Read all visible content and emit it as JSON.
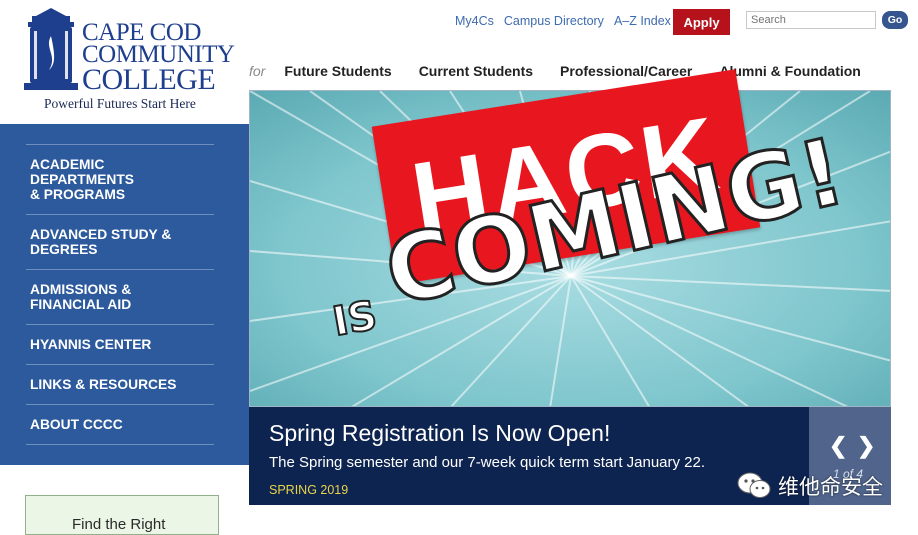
{
  "logo": {
    "line1": "CAPE COD",
    "line2": "COMMUNITY",
    "line3": "COLLEGE",
    "tagline": "Powerful Futures Start Here",
    "icon": "lighthouse-icon"
  },
  "utility_nav": {
    "links": [
      "My4Cs",
      "Campus Directory",
      "A–Z Index"
    ],
    "apply_label": "Apply",
    "search_placeholder": "Search",
    "go_label": "Go"
  },
  "main_nav": {
    "prefix": "for",
    "items": [
      "Future Students",
      "Current Students",
      "Professional/Career",
      "Alumni & Foundation"
    ]
  },
  "sidebar": {
    "items": [
      {
        "label": "ACADEMIC\nDEPARTMENTS\n& PROGRAMS"
      },
      {
        "label": "ADVANCED STUDY &\nDEGREES"
      },
      {
        "label": "ADMISSIONS &\nFINANCIAL AID"
      },
      {
        "label": "HYANNIS CENTER"
      },
      {
        "label": "LINKS & RESOURCES"
      },
      {
        "label": "ABOUT CCCC"
      }
    ],
    "find_box": "Find the Right"
  },
  "hero": {
    "overlay_word": "HACK",
    "small_word": "IS",
    "big_word": "COMING!"
  },
  "slide": {
    "title": "Spring Registration Is Now Open!",
    "description": "The Spring semester and our 7-week quick term start January 22.",
    "term": "SPRING 2019",
    "counter": "1 of 4",
    "prev": "❮",
    "next": "❯"
  },
  "watermark": {
    "text": "维他命安全",
    "icon": "wechat-icon"
  },
  "colors": {
    "brand_blue": "#1e3e8e",
    "sidebar_blue": "#2c5a9c",
    "apply_red": "#b5121b",
    "caption_navy": "#0e2450",
    "term_yellow": "#e8d34a"
  }
}
